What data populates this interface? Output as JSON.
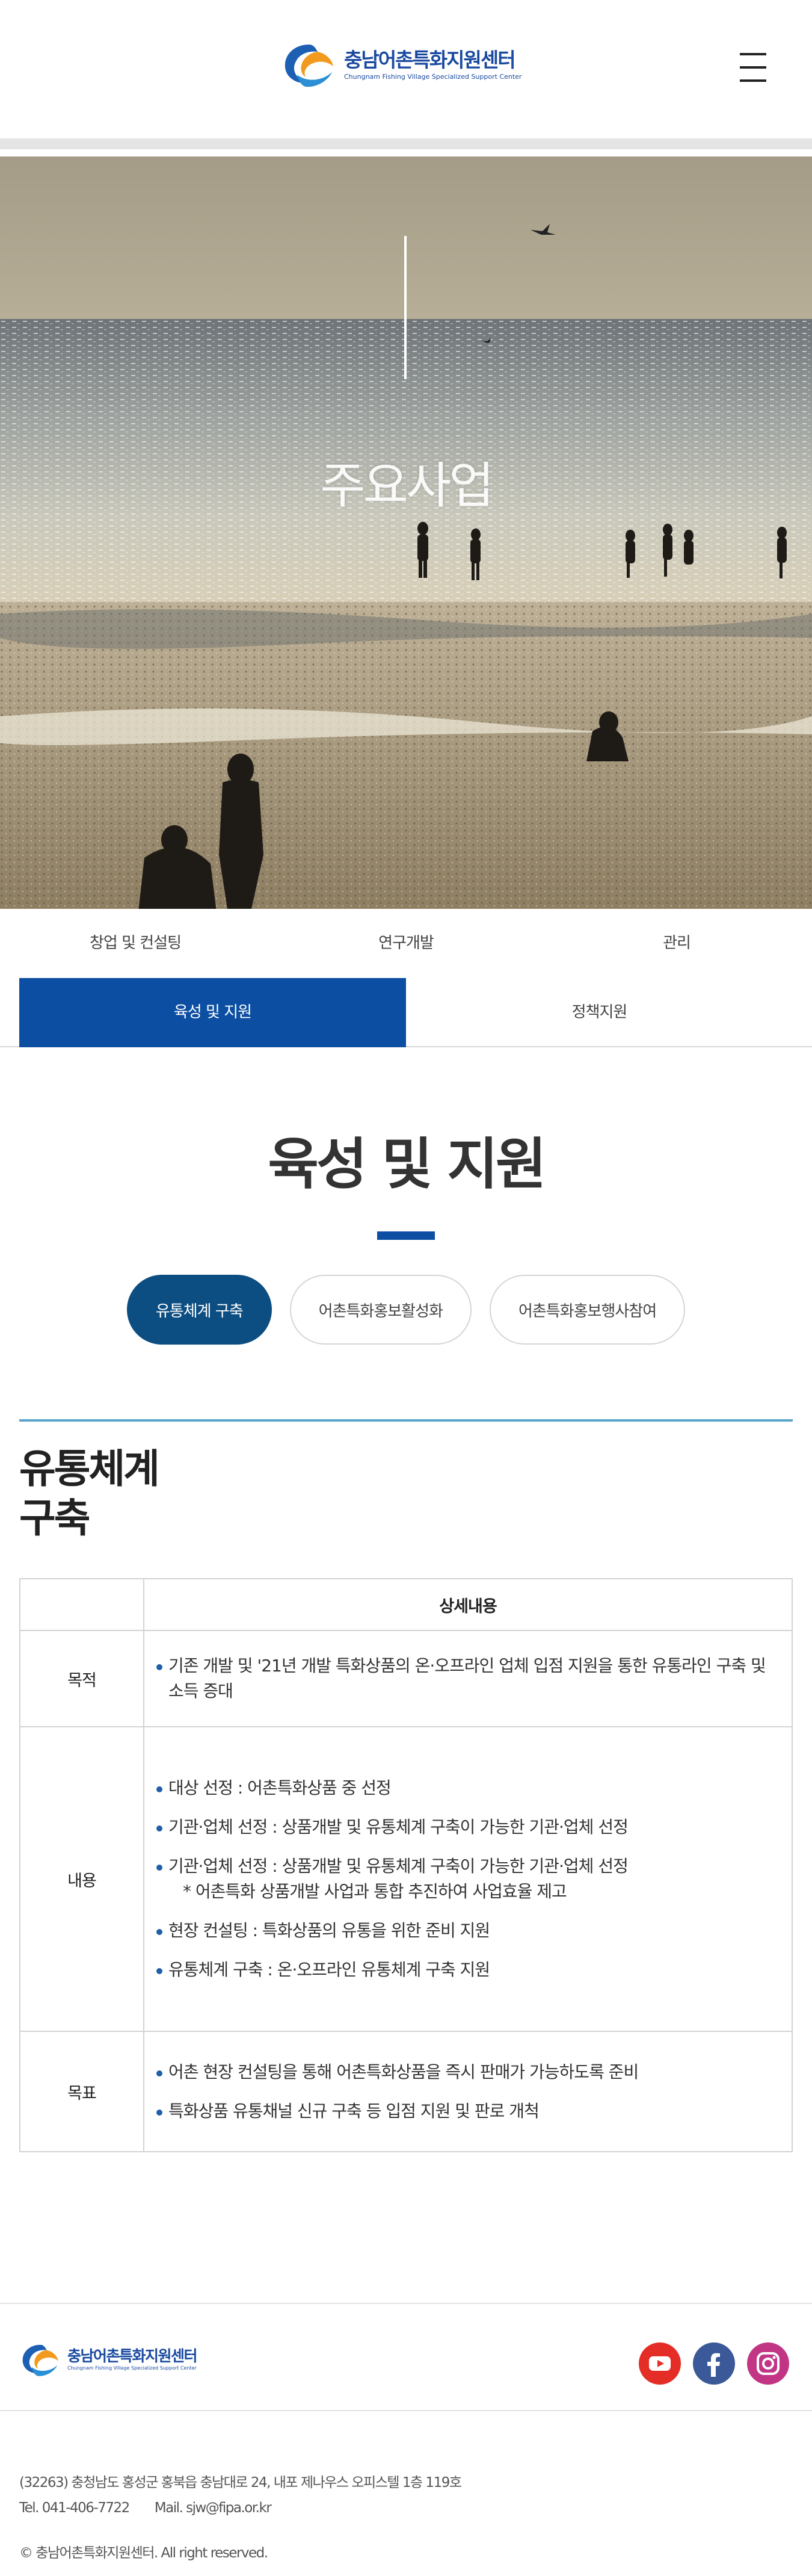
{
  "header": {
    "logo_kr": "충남어촌특화지원센터",
    "logo_en": "Chungnam Fishing Village Specialized Support Center"
  },
  "hero": {
    "title": "주요사업"
  },
  "subnav": {
    "row1": [
      "창업 및 컨설팅",
      "연구개발",
      "관리"
    ],
    "row2": [
      "육성 및 지원",
      "정책지원"
    ]
  },
  "section": {
    "title": "육성 및 지원",
    "pills": [
      "유통체계 구축",
      "어촌특화홍보활성화",
      "어촌특화홍보행사참여"
    ]
  },
  "content": {
    "title_line1": "유통체계",
    "title_line2": "구축",
    "table_header": "상세내용",
    "rows": [
      {
        "label": "목적",
        "items": [
          "기존 개발 및 '21년 개발 특화상품의 온·오프라인 업체 입점 지원을 통한 유통라인 구축 및 소득 증대"
        ]
      },
      {
        "label": "내용",
        "items": [
          "대상 선정 : 어촌특화상품 중 선정",
          "기관·업체 선정 : 상품개발 및 유통체계 구축이 가능한 기관·업체 선정",
          "기관·업체 선정 : 상품개발 및 유통체계 구축이 가능한 기관·업체 선정",
          "현장 컨설팅 : 특화상품의 유통을 위한 준비 지원",
          "유통체계 구축 : 온·오프라인 유통체계 구축 지원"
        ],
        "sub_note": "* 어촌특화 상품개발 사업과 통합 추진하여 사업효율 제고"
      },
      {
        "label": "목표",
        "items": [
          "어촌 현장 컨설팅을 통해 어촌특화상품을 즉시 판매가 가능하도록 준비",
          "특화상품 유통채널 신규 구축 등 입점 지원 및 판로 개척"
        ]
      }
    ]
  },
  "footer": {
    "logo_kr": "충남어촌특화지원센터",
    "logo_en": "Chungnam Fishing Village Specialized Support Center",
    "address": "(32263) 충청남도 홍성군 홍북읍 충남대로 24, 내포 제나우스 오피스텔 1층 119호",
    "tel": "Tel. 041-406-7722",
    "mail": "Mail. sjw@fipa.or.kr",
    "copyright": "© 충남어촌특화지원센터. All right reserved."
  },
  "social": {
    "youtube_color": "#e52d27",
    "facebook_color": "#3b5998",
    "instagram_color": "#c13584"
  },
  "colors": {
    "primary": "#0b4ea2",
    "pill_active": "#0d4e82",
    "divider_accent": "#5aa3c9"
  }
}
